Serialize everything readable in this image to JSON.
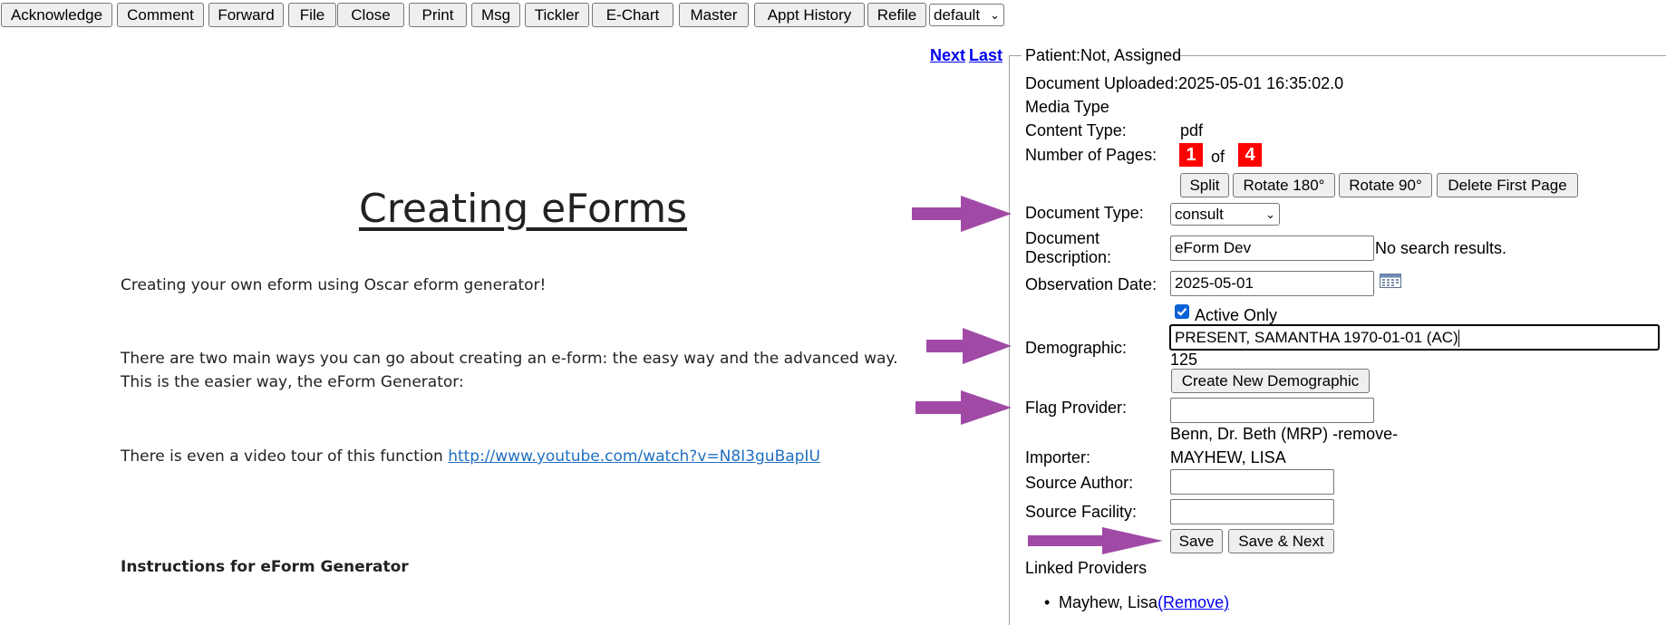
{
  "toolbar": {
    "acknowledge": "Acknowledge",
    "comment": "Comment",
    "forward": "Forward",
    "file": "File",
    "close": "Close",
    "print": "Print",
    "msg": "Msg",
    "tickler": "Tickler",
    "echart": "E-Chart",
    "master": "Master",
    "appt_history": "Appt History",
    "refile": "Refile",
    "queue_select": "default"
  },
  "nav": {
    "next": "Next",
    "last": "Last"
  },
  "document": {
    "title": "Creating eForms",
    "intro": "Creating your own eform using Oscar eform generator!",
    "para1_line1": "There are two main ways you can go about creating an e-form: the easy way and the advanced way.",
    "para1_line2": "This is the easier way, the eForm Generator:",
    "video_text": "There is even a video tour of this function",
    "video_link": "http://www.youtube.com/watch?v=N8I3guBapIU",
    "instructions_heading": "Instructions for eForm Generator"
  },
  "panel": {
    "legend": "Patient:Not, Assigned",
    "uploaded_label": "Document Uploaded:",
    "uploaded_value": "2025-05-01 16:35:02.0",
    "media_type_label": "Media Type",
    "content_type_label": "Content Type:",
    "content_type_value": "pdf",
    "pages_label": "Number of Pages:",
    "page_current": "1",
    "page_of": "of",
    "page_total": "4",
    "split": "Split",
    "rotate180": "Rotate 180°",
    "rotate90": "Rotate 90°",
    "delete_first": "Delete First Page",
    "doc_type_label": "Document Type:",
    "doc_type_value": "consult",
    "desc_label_1": "Document",
    "desc_label_2": "Description:",
    "desc_value": "eForm Dev",
    "desc_status": "No search results.",
    "obs_label": "Observation Date:",
    "obs_value": "2025-05-01",
    "active_only": "Active Only",
    "demographic_label": "Demographic:",
    "demographic_value": "PRESENT, SAMANTHA 1970-01-01 (AC)",
    "demographic_no": "125",
    "create_demographic": "Create New Demographic",
    "flag_label": "Flag Provider:",
    "flag_value": "",
    "flagged_provider": "Benn, Dr. Beth (MRP)",
    "remove_text": "-remove-",
    "importer_label": "Importer:",
    "importer_value": "MAYHEW, LISA",
    "source_author_label": "Source Author:",
    "source_facility_label": "Source Facility:",
    "save": "Save",
    "save_next": "Save & Next",
    "linked_label": "Linked Providers",
    "linked_provider": "Mayhew, Lisa",
    "linked_remove": "(Remove)"
  },
  "colors": {
    "arrow": "#a04aa6",
    "badge": "#ff0000",
    "link": "#0000ee"
  }
}
